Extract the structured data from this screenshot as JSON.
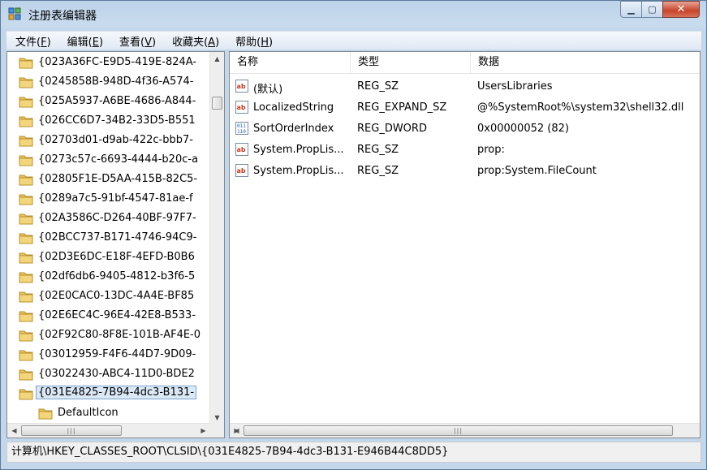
{
  "window": {
    "title": "注册表编辑器",
    "min_symbol": "▁",
    "max_symbol": "▢",
    "close_symbol": "✕"
  },
  "menu": [
    {
      "label": "文件(",
      "accel": "F",
      "tail": ")"
    },
    {
      "label": "编辑(",
      "accel": "E",
      "tail": ")"
    },
    {
      "label": "查看(",
      "accel": "V",
      "tail": ")"
    },
    {
      "label": "收藏夹(",
      "accel": "A",
      "tail": ")"
    },
    {
      "label": "帮助(",
      "accel": "H",
      "tail": ")"
    }
  ],
  "tree": {
    "items": [
      "{023A36FC-E9D5-419E-824A-",
      "{0245858B-948D-4f36-A574-",
      "{025A5937-A6BE-4686-A844-",
      "{026CC6D7-34B2-33D5-B551",
      "{02703d01-d9ab-422c-bbb7-",
      "{0273c57c-6693-4444-b20c-a",
      "{02805F1E-D5AA-415B-82C5-",
      "{0289a7c5-91bf-4547-81ae-f",
      "{02A3586C-D264-40BF-97F7-",
      "{02BCC737-B171-4746-94C9-",
      "{02D3E6DC-E18F-4EFD-B0B6",
      "{02df6db6-9405-4812-b3f6-5",
      "{02E0CAC0-13DC-4A4E-BF85",
      "{02E6EC4C-96E4-42E8-B533-",
      "{02F92C80-8F8E-101B-AF4E-0",
      "{03012959-F4F6-44D7-9D09-",
      "{03022430-ABC4-11D0-BDE2",
      "{031E4825-7B94-4dc3-B131-",
      "DefaultIcon"
    ],
    "selected_index": 17
  },
  "values": {
    "headers": [
      "名称",
      "类型",
      "数据"
    ],
    "rows": [
      {
        "icon": "string-value-icon",
        "name": "(默认)",
        "type": "REG_SZ",
        "data": "UsersLibraries"
      },
      {
        "icon": "string-value-icon",
        "name": "LocalizedString",
        "type": "REG_EXPAND_SZ",
        "data": "@%SystemRoot%\\system32\\shell32.dll"
      },
      {
        "icon": "binary-value-icon",
        "name": "SortOrderIndex",
        "type": "REG_DWORD",
        "data": "0x00000052 (82)"
      },
      {
        "icon": "string-value-icon",
        "name": "System.PropLis...",
        "type": "REG_SZ",
        "data": "prop:"
      },
      {
        "icon": "string-value-icon",
        "name": "System.PropLis...",
        "type": "REG_SZ",
        "data": "prop:System.FileCount"
      }
    ]
  },
  "statusbar": {
    "path": "计算机\\HKEY_CLASSES_ROOT\\CLSID\\{031E4825-7B94-4dc3-B131-E946B44C8DD5}"
  },
  "colors": {
    "selection_bg": "#dbe9f7",
    "selection_border": "#7da2ce",
    "folder": "#e8c35a",
    "close_button": "#c7442a"
  }
}
